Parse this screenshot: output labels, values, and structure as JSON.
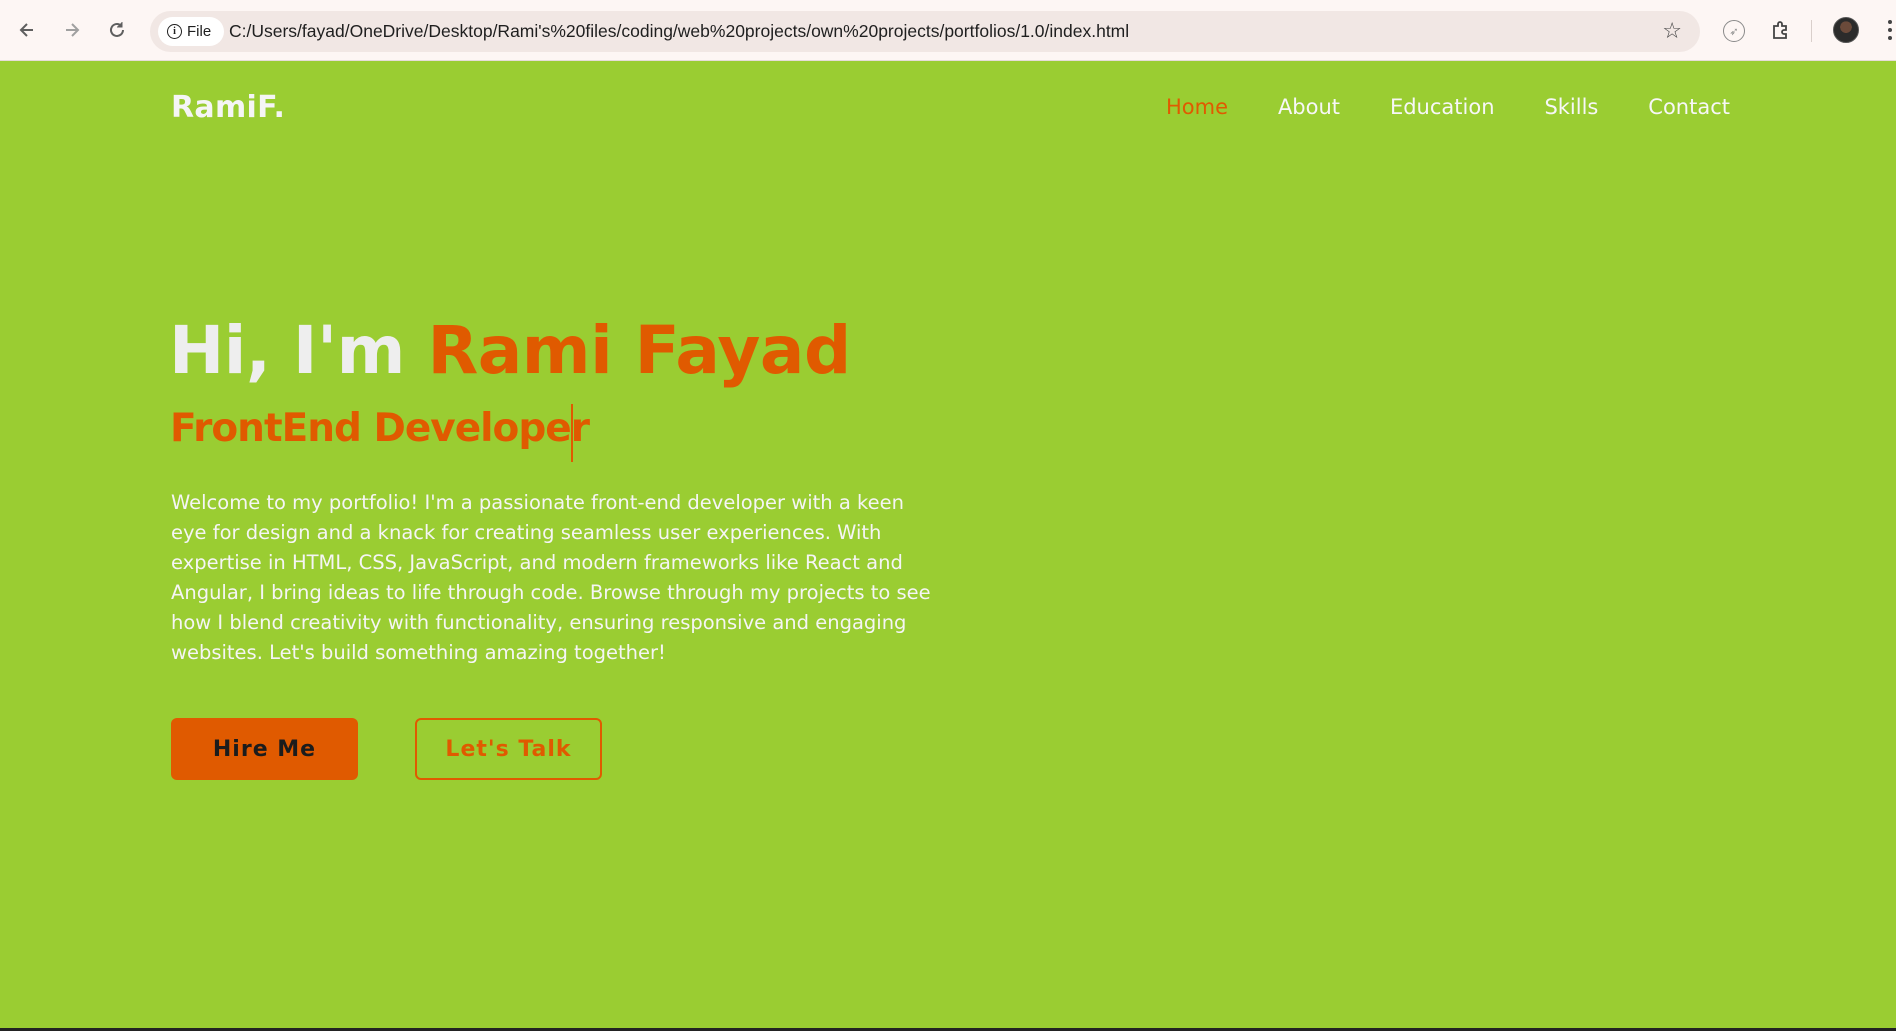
{
  "browser": {
    "url_scheme_label": "File",
    "url": "C:/Users/fayad/OneDrive/Desktop/Rami's%20files/coding/web%20projects/own%20projects/portfolios/1.0/index.html"
  },
  "site": {
    "logo": "RamiF.",
    "nav": [
      {
        "label": "Home",
        "active": true
      },
      {
        "label": "About",
        "active": false
      },
      {
        "label": "Education",
        "active": false
      },
      {
        "label": "Skills",
        "active": false
      },
      {
        "label": "Contact",
        "active": false
      }
    ]
  },
  "hero": {
    "greeting": "Hi, I'm",
    "name": "Rami Fayad",
    "subtitle": "FrontEnd Developer",
    "intro": "Welcome to my portfolio! I'm a passionate front-end developer with a keen eye for design and a knack for creating seamless user experiences. With expertise in HTML, CSS, JavaScript, and modern frameworks like React and Angular, I bring ideas to life through code. Browse through my projects to see how I blend creativity with functionality, ensuring responsive and engaging websites. Let's build something amazing together!",
    "primary_button": "Hire Me",
    "secondary_button": "Let's Talk"
  },
  "colors": {
    "background": "#9acd32",
    "accent": "#e05a00",
    "text_light": "#f5f5f5"
  },
  "icons": {
    "back": "arrow-left-icon",
    "forward": "arrow-right-icon",
    "reload": "reload-icon",
    "info": "info-icon",
    "bookmark": "star-icon",
    "extension_1": "compass-icon",
    "extensions": "puzzle-icon",
    "profile": "avatar",
    "menu": "more-vertical-icon"
  }
}
